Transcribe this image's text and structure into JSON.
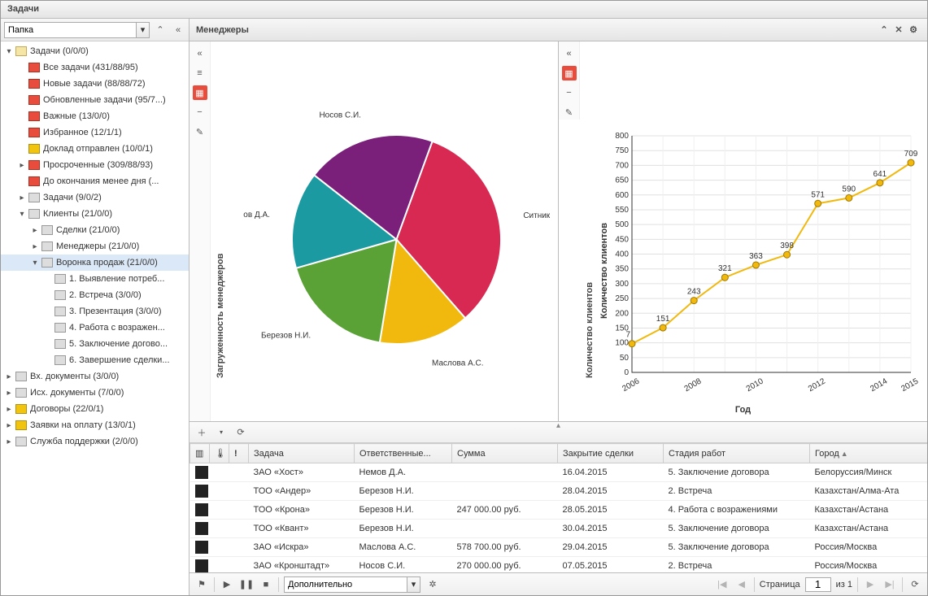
{
  "window": {
    "title": "Задачи"
  },
  "sidebar": {
    "folder_label": "Папка",
    "items": [
      {
        "d": 0,
        "tw": "▾",
        "ic": "folder",
        "label": "Задачи (0/0/0)"
      },
      {
        "d": 1,
        "tw": "",
        "ic": "red",
        "label": "Все задачи (431/88/95)"
      },
      {
        "d": 1,
        "tw": "",
        "ic": "red",
        "label": "Новые задачи (88/88/72)"
      },
      {
        "d": 1,
        "tw": "",
        "ic": "red",
        "label": "Обновленные задачи (95/7...)"
      },
      {
        "d": 1,
        "tw": "",
        "ic": "red",
        "label": "Важные (13/0/0)"
      },
      {
        "d": 1,
        "tw": "",
        "ic": "red",
        "label": "Избранное (12/1/1)"
      },
      {
        "d": 1,
        "tw": "",
        "ic": "yel",
        "label": "Доклад отправлен (10/0/1)"
      },
      {
        "d": 1,
        "tw": "▸",
        "ic": "red",
        "label": "Просроченные (309/88/93)"
      },
      {
        "d": 1,
        "tw": "",
        "ic": "red",
        "label": "До окончания менее дня (..."
      },
      {
        "d": 1,
        "tw": "▸",
        "ic": "gray",
        "label": "Задачи (9/0/2)"
      },
      {
        "d": 1,
        "tw": "▾",
        "ic": "gray",
        "label": "Клиенты (21/0/0)"
      },
      {
        "d": 2,
        "tw": "▸",
        "ic": "gray",
        "label": "Сделки (21/0/0)"
      },
      {
        "d": 2,
        "tw": "▸",
        "ic": "gray",
        "label": "Менеджеры (21/0/0)"
      },
      {
        "d": 2,
        "tw": "▾",
        "ic": "gray",
        "label": "Воронка продаж (21/0/0)",
        "sel": true
      },
      {
        "d": 3,
        "tw": "",
        "ic": "gray",
        "label": "1. Выявление потреб..."
      },
      {
        "d": 3,
        "tw": "",
        "ic": "gray",
        "label": "2. Встреча (3/0/0)"
      },
      {
        "d": 3,
        "tw": "",
        "ic": "gray",
        "label": "3. Презентация (3/0/0)"
      },
      {
        "d": 3,
        "tw": "",
        "ic": "gray",
        "label": "4. Работа с возражен..."
      },
      {
        "d": 3,
        "tw": "",
        "ic": "gray",
        "label": "5. Заключение догово..."
      },
      {
        "d": 3,
        "tw": "",
        "ic": "gray",
        "label": "6. Завершение сделки..."
      },
      {
        "d": 0,
        "tw": "▸",
        "ic": "gray",
        "label": "Вх. документы (3/0/0)"
      },
      {
        "d": 0,
        "tw": "▸",
        "ic": "gray",
        "label": "Исх. документы (7/0/0)"
      },
      {
        "d": 0,
        "tw": "▸",
        "ic": "yel",
        "label": "Договоры (22/0/1)"
      },
      {
        "d": 0,
        "tw": "▸",
        "ic": "yel",
        "label": "Заявки на оплату (13/0/1)"
      },
      {
        "d": 0,
        "tw": "▸",
        "ic": "gray",
        "label": "Служба поддержки (2/0/0)"
      }
    ]
  },
  "panel": {
    "title": "Менеджеры"
  },
  "chart_data": [
    {
      "type": "pie",
      "title": "Загруженность менеджеров",
      "series": [
        {
          "name": "Ситников А.А.",
          "value": 33,
          "color": "#d82952"
        },
        {
          "name": "Маслова А.С.",
          "value": 14,
          "color": "#f1b80e"
        },
        {
          "name": "Березов Н.И.",
          "value": 18,
          "color": "#5aa236"
        },
        {
          "name": "Немов Д.А.",
          "value": 15,
          "color": "#1b9aa2"
        },
        {
          "name": "Носов С.И.",
          "value": 20,
          "color": "#7a1f7a"
        }
      ]
    },
    {
      "type": "line",
      "title": "Количество клиентов",
      "xlabel": "Год",
      "ylabel": "Количество клиентов",
      "ylim": [
        0,
        800
      ],
      "x": [
        2006,
        2007,
        2008,
        2009,
        2010,
        2011,
        2012,
        2013,
        2014,
        2015
      ],
      "values": [
        97,
        151,
        243,
        321,
        363,
        398,
        571,
        590,
        641,
        709
      ],
      "labels": [
        "7",
        "151",
        "243",
        "321",
        "363",
        "398",
        "571",
        "590",
        "641",
        "709"
      ],
      "line_color": "#f1b80e"
    }
  ],
  "grid": {
    "columns": [
      "",
      "",
      "",
      "Задача",
      "Ответственные...",
      "Сумма",
      "Закрытие сделки",
      "Стадия работ",
      "Город"
    ],
    "sort_col": 8,
    "rows": [
      [
        "ЗАО «Хост»",
        "Немов Д.А.",
        "",
        "16.04.2015",
        "5. Заключение договора",
        "Белоруссия/Минск"
      ],
      [
        "ТОО «Андер»",
        "Березов Н.И.",
        "",
        "28.04.2015",
        "2. Встреча",
        "Казахстан/Алма-Ата"
      ],
      [
        "ТОО «Крона»",
        "Березов Н.И.",
        "247 000.00 руб.",
        "28.05.2015",
        "4. Работа с возражениями",
        "Казахстан/Астана"
      ],
      [
        "ТОО «Квант»",
        "Березов Н.И.",
        "",
        "30.04.2015",
        "5. Заключение договора",
        "Казахстан/Астана"
      ],
      [
        "ЗАО «Искра»",
        "Маслова А.С.",
        "578 700.00 руб.",
        "29.04.2015",
        "5. Заключение договора",
        "Россия/Москва"
      ],
      [
        "ЗАО «Кронштадт»",
        "Носов С.И.",
        "270 000.00 руб.",
        "07.05.2015",
        "2. Встреча",
        "Россия/Москва"
      ]
    ]
  },
  "footer": {
    "extra_label": "Дополнительно",
    "page_label": "Страница",
    "page_value": "1",
    "of_label": "из 1"
  }
}
